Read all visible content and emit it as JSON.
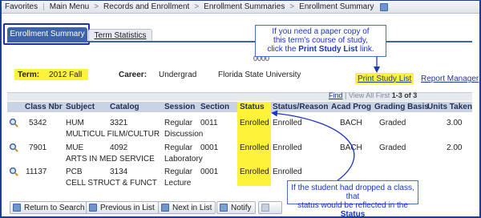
{
  "nav": {
    "favorites": "Favorites",
    "main_menu": "Main Menu",
    "records": "Records and Enrollment",
    "summaries": "Enrollment Summaries",
    "current": "Enrollment Summary",
    "sep": ">",
    "pipe": "|"
  },
  "tabs": {
    "active": "Enrollment Summary",
    "inactive": "Term Statistics"
  },
  "partial_id": "0000",
  "info": {
    "term_label": "Term:",
    "term_value": "2012 Fall",
    "career_label": "Career:",
    "career_value": "Undergrad",
    "institution": "Florida State University",
    "print_link": "Print Study List",
    "report_link": "Report Manager"
  },
  "callouts": {
    "top_line1": "If you need a paper copy of",
    "top_line2": "this term's course of study,",
    "top_line3_pre": "click the ",
    "top_line3_bold": "Print Study List",
    "top_line3_post": " link.",
    "bottom_line1": "If the student had dropped a class, that",
    "bottom_line2_pre": "status would be reflected in the ",
    "bottom_line2_bold": "Status"
  },
  "grid_nav": {
    "find": "Find",
    "sep": "|",
    "view_all": "View All",
    "first": "First",
    "count": "1-3 of 3"
  },
  "columns": {
    "class_nbr": "Class Nbr",
    "subject": "Subject",
    "catalog": "Catalog",
    "session": "Session",
    "section": "Section",
    "status": "Status",
    "status_reason": "Status/Reason",
    "acad_prog": "Acad Prog",
    "grading_basis": "Grading Basis",
    "units_taken": "Units Taken"
  },
  "rows": [
    {
      "class_nbr": "5342",
      "subject": "HUM",
      "catalog": "3321",
      "session": "Regular",
      "section": "0011",
      "status": "Enrolled",
      "status_reason": "Enrolled",
      "acad_prog": "BACH",
      "grading_basis": "Graded",
      "units": "3.00",
      "description": "MULTICUL FILM/CULTUR",
      "component": "Discussion"
    },
    {
      "class_nbr": "7901",
      "subject": "MUE",
      "catalog": "4092",
      "session": "Regular",
      "section": "0001",
      "status": "Enrolled",
      "status_reason": "Enrolled",
      "acad_prog": "BACH",
      "grading_basis": "Graded",
      "units": "2.00",
      "description": "ARTS IN MED SERVICE",
      "component": "Laboratory"
    },
    {
      "class_nbr": "11137",
      "subject": "PCB",
      "catalog": "3134",
      "session": "Regular",
      "section": "0001",
      "status": "Enrolled",
      "status_reason": "Enrolled",
      "acad_prog": "BACH",
      "grading_basis": "Graded",
      "units": "3.00",
      "description": "CELL STRUCT & FUNCT",
      "component": "Lecture"
    }
  ],
  "buttons": {
    "return": "Return to Search",
    "previous": "Previous in List",
    "next": "Next in List",
    "notify": "Notify"
  },
  "colors": {
    "highlight": "#fff23a",
    "accent": "#3c64a8",
    "callout_text": "#1a34c8"
  }
}
